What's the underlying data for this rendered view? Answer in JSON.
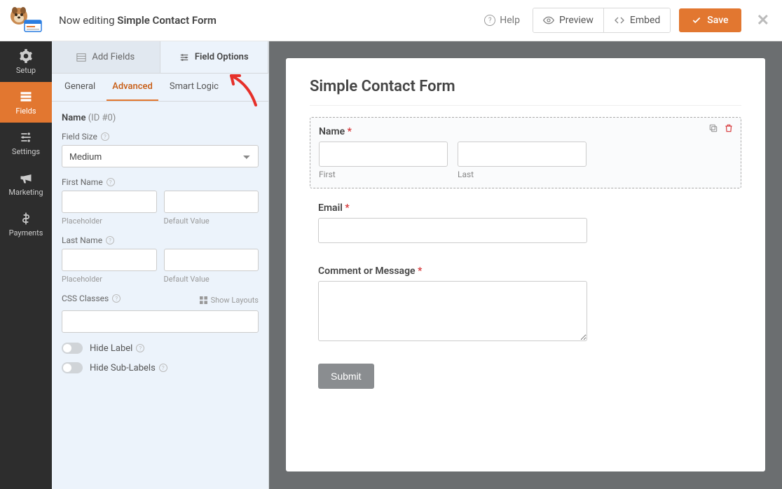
{
  "header": {
    "editing_prefix": "Now editing ",
    "form_name": "Simple Contact Form",
    "help": "Help",
    "preview": "Preview",
    "embed": "Embed",
    "save": "Save"
  },
  "leftnav": {
    "setup": "Setup",
    "fields": "Fields",
    "settings": "Settings",
    "marketing": "Marketing",
    "payments": "Payments"
  },
  "panel_tabs": {
    "add_fields": "Add Fields",
    "field_options": "Field Options"
  },
  "sub_tabs": {
    "general": "General",
    "advanced": "Advanced",
    "smart_logic": "Smart Logic"
  },
  "options": {
    "field_name_label": "Name",
    "field_id": "(ID #0)",
    "field_size_label": "Field Size",
    "field_size_value": "Medium",
    "first_name_label": "First Name",
    "last_name_label": "Last Name",
    "placeholder_hint": "Placeholder",
    "default_value_hint": "Default Value",
    "css_classes_label": "CSS Classes",
    "show_layouts": "Show Layouts",
    "hide_label": "Hide Label",
    "hide_sublabels": "Hide Sub-Labels"
  },
  "form": {
    "title": "Simple Contact Form",
    "name_label": "Name",
    "first_sub": "First",
    "last_sub": "Last",
    "email_label": "Email",
    "comment_label": "Comment or Message",
    "submit": "Submit"
  }
}
